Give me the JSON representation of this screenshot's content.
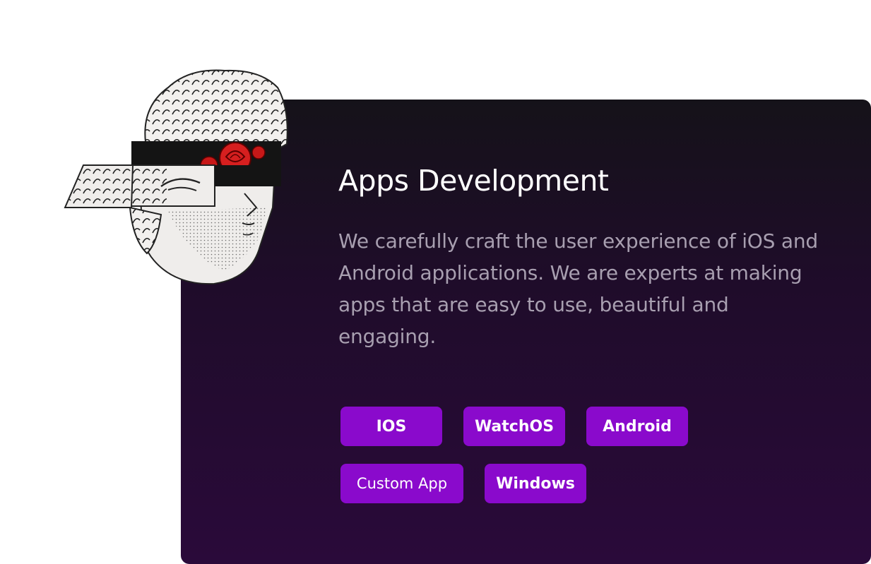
{
  "service": {
    "title": "Apps Development",
    "description": "We carefully craft the user experience of iOS and Android applications. We are experts at making apps that are easy to use, beautiful and engaging."
  },
  "tags": [
    {
      "label": "IOS"
    },
    {
      "label": "WatchOS"
    },
    {
      "label": "Android"
    },
    {
      "label": "Custom App"
    },
    {
      "label": "Windows"
    }
  ],
  "colors": {
    "card_top": "#151219",
    "card_bottom": "#2a0a3a",
    "tag_bg": "#8a0acc",
    "title": "#ffffff",
    "description": "#a89fb0",
    "rose": "#d61f1f"
  },
  "illustration": {
    "icon": "statue-head-with-rose-blindfold-icon"
  }
}
